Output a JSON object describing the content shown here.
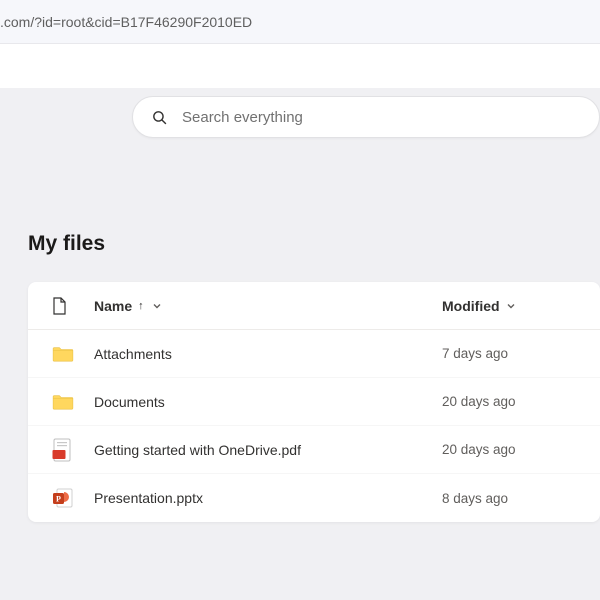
{
  "url_fragment": ".com/?id=root&cid=B17F46290F2010ED",
  "search": {
    "placeholder": "Search everything"
  },
  "page_title": "My files",
  "columns": {
    "name_label": "Name",
    "sort_arrow": "↑",
    "modified_label": "Modified"
  },
  "files": [
    {
      "icon": "folder",
      "name": "Attachments",
      "modified": "7 days ago"
    },
    {
      "icon": "folder",
      "name": "Documents",
      "modified": "20 days ago"
    },
    {
      "icon": "pdf",
      "name": "Getting started with OneDrive.pdf",
      "modified": "20 days ago"
    },
    {
      "icon": "pptx",
      "name": "Presentation.pptx",
      "modified": "8 days ago"
    }
  ]
}
